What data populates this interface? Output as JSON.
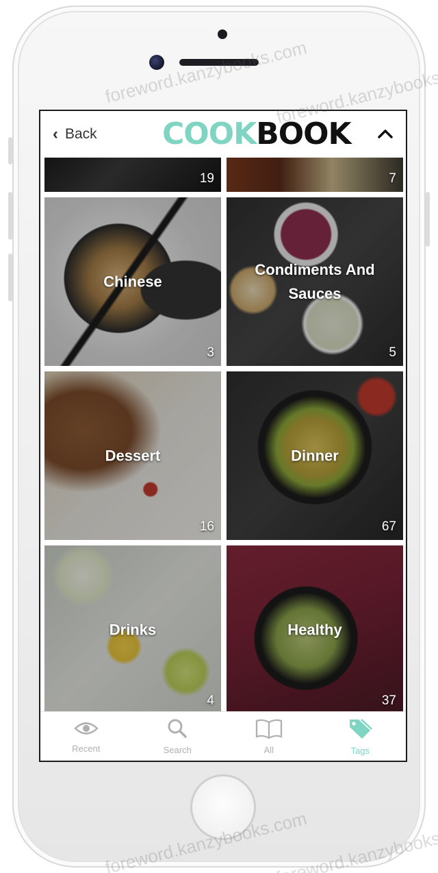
{
  "header": {
    "back_label": "Back",
    "logo_part1": "COOK",
    "logo_part2": "BOOK"
  },
  "colors": {
    "accent": "#7fd4c2",
    "logo_dark": "#111111",
    "tab_inactive": "#b0b0b0"
  },
  "tiles": [
    {
      "name": "",
      "count": "19"
    },
    {
      "name": "",
      "count": "7"
    },
    {
      "name": "Chinese",
      "count": "3"
    },
    {
      "name": "Condiments And Sauces",
      "count": "5"
    },
    {
      "name": "Dessert",
      "count": "16"
    },
    {
      "name": "Dinner",
      "count": "67"
    },
    {
      "name": "Drinks",
      "count": "4"
    },
    {
      "name": "Healthy",
      "count": "37"
    }
  ],
  "tabbar": {
    "items": [
      {
        "label": "Recent",
        "icon": "eye-icon"
      },
      {
        "label": "Search",
        "icon": "search-icon"
      },
      {
        "label": "All",
        "icon": "book-icon"
      },
      {
        "label": "Tags",
        "icon": "tag-icon",
        "active": true
      }
    ]
  },
  "watermark": "foreword.kanzybooks.com"
}
